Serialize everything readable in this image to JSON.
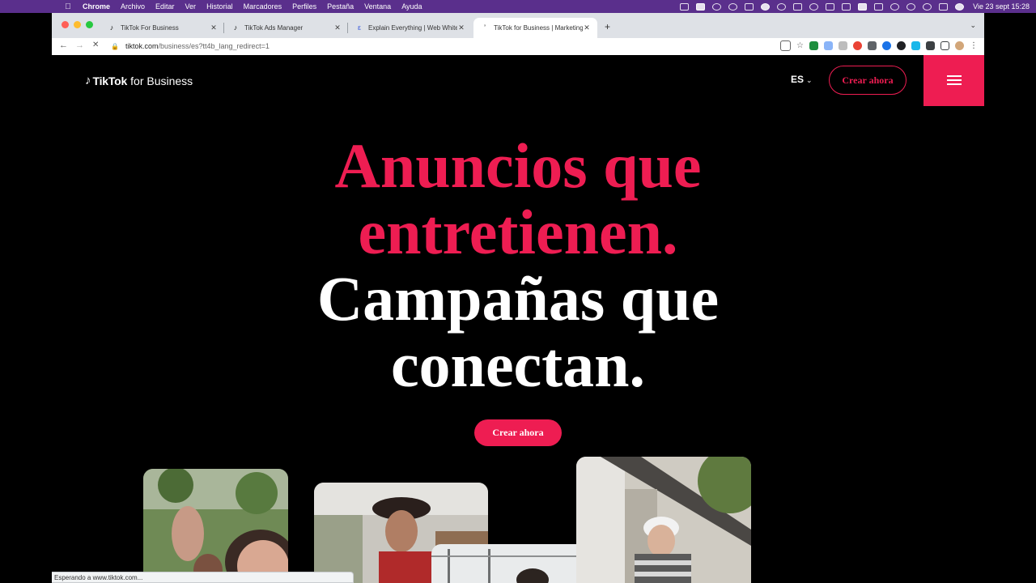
{
  "menubar": {
    "app": "Chrome",
    "items": [
      "Archivo",
      "Editar",
      "Ver",
      "Historial",
      "Marcadores",
      "Perfiles",
      "Pestaña",
      "Ventana",
      "Ayuda"
    ],
    "clock": "Vie 23 sept  15:28"
  },
  "tabs": [
    {
      "title": "TikTok For Business"
    },
    {
      "title": "TikTok Ads Manager"
    },
    {
      "title": "Explain Everything | Web Whiteboard"
    },
    {
      "title": "TikTok for Business | Marketing"
    }
  ],
  "address": {
    "host": "tiktok.com",
    "path": "/business/es?tt4b_lang_redirect=1"
  },
  "header": {
    "brand": "TikTok",
    "brand_suffix": "for Business",
    "language": "ES",
    "cta": "Crear ahora"
  },
  "hero": {
    "line1": "Anuncios que",
    "line2": "entretienen.",
    "line3": "Campañas que",
    "line4": "conectan.",
    "cta": "Crear ahora"
  },
  "status_text": "Esperando a www.tiktok.com...",
  "colors": {
    "accent": "#ee1d52",
    "menubar": "#5a2f8c",
    "page_bg": "#000000"
  }
}
